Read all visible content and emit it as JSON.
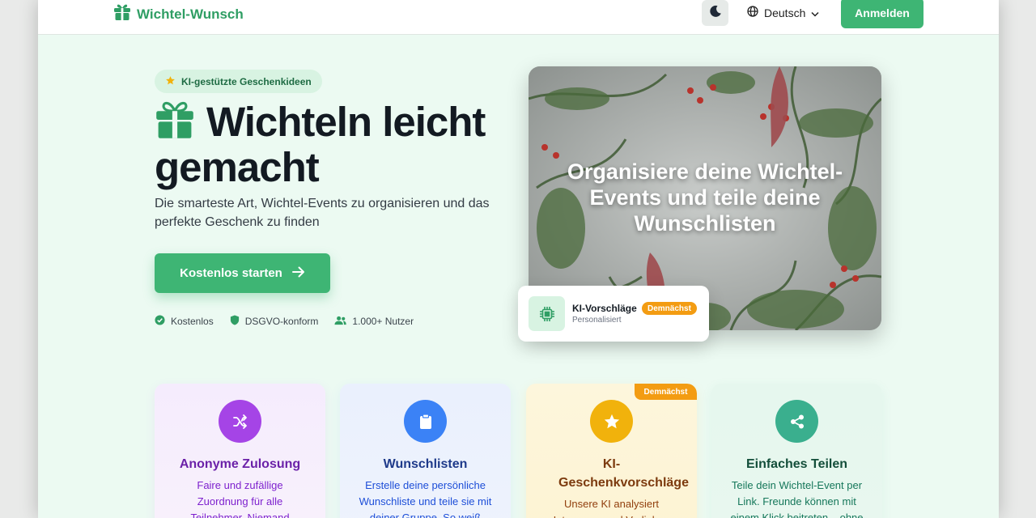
{
  "nav": {
    "brand": "Wichtel-Wunsch",
    "language": "Deutsch",
    "login": "Anmelden"
  },
  "hero": {
    "badge": "KI-gestützte Geschenkideen",
    "title": "Wichteln leicht gemacht",
    "subtitle": "Die smarteste Art, Wichtel-Events zu organisieren und das perfekte Geschenk zu finden",
    "cta": "Kostenlos starten",
    "features": [
      "Kostenlos",
      "DSGVO-konform",
      "1.000+ Nutzer"
    ],
    "image_text": "Organisiere deine Wichtel-Events und teile deine Wunschlisten"
  },
  "ki_card": {
    "title": "KI-Vorschläge",
    "badge": "Demnächst",
    "subtitle": "Personalisiert"
  },
  "cards": [
    {
      "title": "Anonyme Zulosung",
      "text": "Faire und zufällige Zuordnung für alle Teilnehmer. Niemand",
      "icon": "shuffle-icon",
      "color": "#a544e6"
    },
    {
      "title": "Wunschlisten",
      "text": "Erstelle deine persönliche Wunschliste und teile sie mit deiner Gruppe. So weiß",
      "icon": "clipboard-icon",
      "color": "#3b82f6"
    },
    {
      "title": "KI-Geschenkvorschläge",
      "text": "Unsere KI analysiert Interessen und Vorlieben",
      "icon": "star-icon",
      "color": "#f1b20c",
      "ribbon": "Demnächst"
    },
    {
      "title": "Einfaches Teilen",
      "text": "Teile dein Wichtel-Event per Link. Freunde können mit einem Klick beitreten – ohne",
      "icon": "share-icon",
      "color": "#3aaf8e"
    }
  ],
  "colors": {
    "primary": "#3eb574",
    "brand_text": "#2f9e64",
    "accent_orange": "#f39c12",
    "page_bg": "#ecfaf2"
  }
}
